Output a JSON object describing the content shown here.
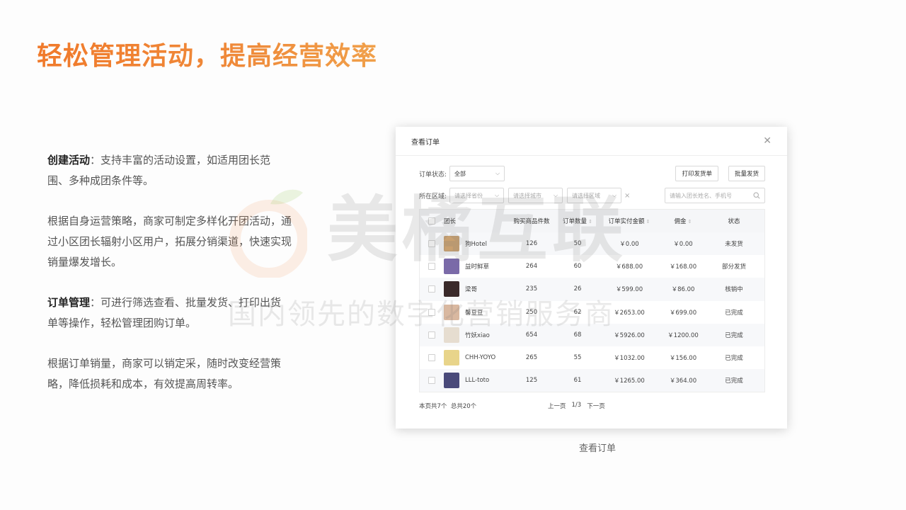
{
  "headline": "轻松管理活动，提高经营效率",
  "description": {
    "p1_bold": "创建活动",
    "p1_text": "：支持丰富的活动设置，如适用团长范围、多种成团条件等。",
    "p2_text": "根据自身运营策略，商家可制定多样化开团活动，通过小区团长辐射小区用户，拓展分销渠道，快速实现销量爆发增长。",
    "p3_bold": "订单管理",
    "p3_text": "：可进行筛选查看、批量发货、打印出货单等操作，轻松管理团购订单。",
    "p4_text": "根据订单销量，商家可以销定采，随时改变经营策略，降低损耗和成本，有效提高周转率。"
  },
  "watermark": {
    "brand": "美橘互联",
    "slogan": "国内领先的数字化营销服务商"
  },
  "dialog": {
    "title": "查看订单",
    "close_icon": "close-icon",
    "status_label": "订单状态:",
    "status_value": "全部",
    "print_button": "打印发货单",
    "batch_button": "批量发货",
    "region_label": "所在区域:",
    "province_placeholder": "请选择省份",
    "city_placeholder": "请选择城市",
    "district_placeholder": "请选择区域",
    "search_placeholder": "请输入团长姓名、手机号",
    "columns": [
      "团长",
      "购买商品件数",
      "订单数量",
      "订单实付金额",
      "佣金",
      "状态"
    ],
    "rows": [
      {
        "name": "狗Hotel",
        "items": "126",
        "orders": "50",
        "amount": "￥0.00",
        "commission": "￥0.00",
        "status": "未发货",
        "avatar": "#c8a070"
      },
      {
        "name": "益时鲜草",
        "items": "264",
        "orders": "60",
        "amount": "￥688.00",
        "commission": "￥168.00",
        "status": "部分发货",
        "avatar": "#7a6aa8"
      },
      {
        "name": "梁哥",
        "items": "235",
        "orders": "26",
        "amount": "￥599.00",
        "commission": "￥86.00",
        "status": "核销中",
        "avatar": "#3a2a2a"
      },
      {
        "name": "馨豆豆",
        "items": "250",
        "orders": "62",
        "amount": "￥2653.00",
        "commission": "￥699.00",
        "status": "已完成",
        "avatar": "#d9b8a0"
      },
      {
        "name": "竹妖xiao",
        "items": "654",
        "orders": "68",
        "amount": "￥5926.00",
        "commission": "￥1200.00",
        "status": "已完成",
        "avatar": "#e6ddd0"
      },
      {
        "name": "CHH-YOYO",
        "items": "265",
        "orders": "55",
        "amount": "￥1032.00",
        "commission": "￥156.00",
        "status": "已完成",
        "avatar": "#e8d48a"
      },
      {
        "name": "LLL-toto",
        "items": "125",
        "orders": "61",
        "amount": "￥1265.00",
        "commission": "￥364.00",
        "status": "已完成",
        "avatar": "#4a4a7a"
      }
    ],
    "footer_count": "本页共7个",
    "footer_total": "总共20个",
    "prev_page": "上一页",
    "page_indicator": "1/3",
    "next_page": "下一页"
  },
  "caption": "查看订单"
}
